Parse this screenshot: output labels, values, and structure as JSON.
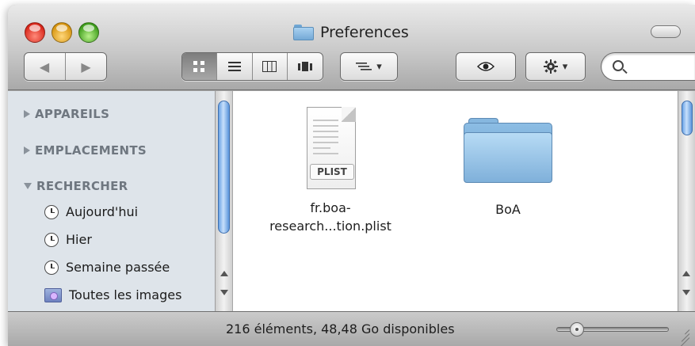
{
  "window": {
    "title": "Preferences"
  },
  "toolbar": {
    "view_buttons": [
      "icon-view",
      "list-view",
      "column-view",
      "cover-flow-view"
    ],
    "search": {
      "placeholder": ""
    }
  },
  "sidebar": {
    "sections": [
      {
        "label": "APPAREILS",
        "expanded": false
      },
      {
        "label": "EMPLACEMENTS",
        "expanded": false
      },
      {
        "label": "RECHERCHER",
        "expanded": true
      }
    ],
    "items": [
      {
        "label": "Aujourd'hui",
        "icon": "clock-icon"
      },
      {
        "label": "Hier",
        "icon": "clock-icon"
      },
      {
        "label": "Semaine passée",
        "icon": "clock-icon"
      },
      {
        "label": "Toutes les images",
        "icon": "images-icon"
      }
    ]
  },
  "files": [
    {
      "label_line1": "fr.boa-",
      "label_line2": "research...tion.plist",
      "badge": "PLIST",
      "kind": "plist"
    },
    {
      "label_line1": "BoA",
      "kind": "folder"
    }
  ],
  "statusbar": {
    "text": "216 éléments, 48,48 Go disponibles",
    "zoom_level": 0.18
  },
  "colors": {
    "sidebar_bg": "#dee4ea",
    "section_label": "#6f7780",
    "scroll_thumb": "#6aa3e6",
    "folder": "#8cbde4"
  }
}
